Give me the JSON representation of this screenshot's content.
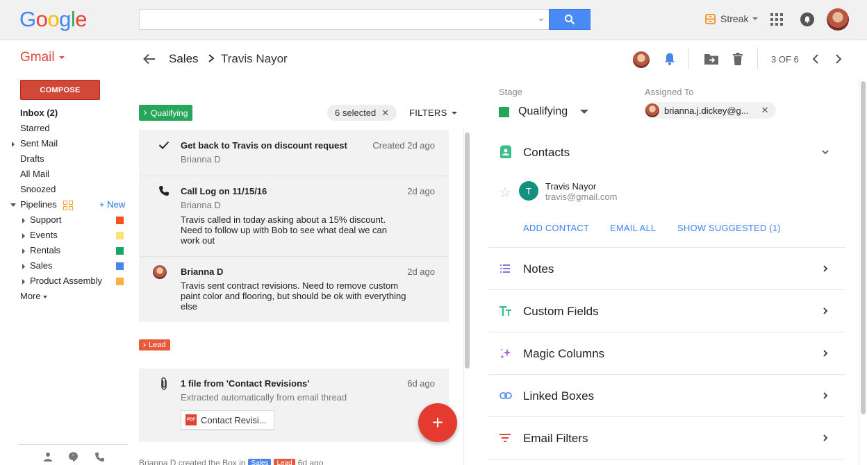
{
  "header": {
    "logo_letters": [
      {
        "ch": "G",
        "color": "#4285f4"
      },
      {
        "ch": "o",
        "color": "#ea4335"
      },
      {
        "ch": "o",
        "color": "#fbbc05"
      },
      {
        "ch": "g",
        "color": "#4285f4"
      },
      {
        "ch": "l",
        "color": "#34a853"
      },
      {
        "ch": "e",
        "color": "#ea4335"
      }
    ],
    "search_value": "",
    "streak_label": "Streak"
  },
  "nav": {
    "app_label": "Gmail",
    "compose_label": "COMPOSE",
    "items": [
      {
        "label": "Inbox (2)"
      },
      {
        "label": "Starred"
      },
      {
        "label": "Sent Mail"
      },
      {
        "label": "Drafts"
      },
      {
        "label": "All Mail"
      },
      {
        "label": "Snoozed"
      }
    ],
    "pipelines_label": "Pipelines",
    "new_label": "+ New",
    "pipelines": [
      {
        "label": "Support",
        "color": "#f4511e"
      },
      {
        "label": "Events",
        "color": "#fde07a"
      },
      {
        "label": "Rentals",
        "color": "#16a765"
      },
      {
        "label": "Sales",
        "color": "#4a86e8"
      },
      {
        "label": "Product Assembly",
        "color": "#ffad46"
      }
    ],
    "more_label": "More"
  },
  "box_header": {
    "breadcrumb_pipeline": "Sales",
    "breadcrumb_box": "Travis Nayor",
    "pagination": "3 OF 6"
  },
  "timeline": {
    "stage_badge": "Qualifying",
    "selected_chip": "6 selected",
    "filters_label": "FILTERS",
    "entries": [
      {
        "title": "Get back to Travis on discount request",
        "time": "Created 2d ago",
        "sub": "Brianna D",
        "body": ""
      },
      {
        "title": "Call Log on 11/15/16",
        "time": "2d ago",
        "sub": "Brianna D",
        "body": "Travis called in today asking about a 15% discount. Need to follow up with Bob to see what deal we can work out"
      },
      {
        "title": "Brianna D",
        "time": "2d ago",
        "sub": "",
        "body": "Travis sent contract revisions. Need to remove custom paint color and flooring, but should be ok with everything else"
      }
    ],
    "lead_badge": "Lead",
    "file_entry": {
      "title": "1 file from 'Contact Revisions'",
      "time": "6d ago",
      "sub": "Extracted automatically from email thread",
      "file_label": "Contact Revisi...",
      "file_type": "PDF"
    },
    "footer": {
      "text": "Brianna D created the Box in",
      "pipeline_badge": "Sales",
      "stage_badge": "Lead",
      "time": "6d ago"
    },
    "fab_label": "+"
  },
  "details": {
    "stage_label": "Stage",
    "stage_value": "Qualifying",
    "assigned_label": "Assigned To",
    "assigned_value": "brianna.j.dickey@g...",
    "sections": {
      "contacts": "Contacts",
      "notes": "Notes",
      "custom_fields": "Custom Fields",
      "magic_columns": "Magic Columns",
      "linked_boxes": "Linked Boxes",
      "email_filters": "Email Filters"
    },
    "contact": {
      "initial": "T",
      "name": "Travis Nayor",
      "email": "travis@gmail.com"
    },
    "actions": {
      "add_contact": "ADD CONTACT",
      "email_all": "EMAIL ALL",
      "show_suggested": "SHOW SUGGESTED (1)"
    }
  },
  "colors": {
    "accent": "#4285f4",
    "compose": "#d14836",
    "qualifying": "#26a65b",
    "lead": "#e85a3c",
    "fab": "#e53a2f"
  }
}
